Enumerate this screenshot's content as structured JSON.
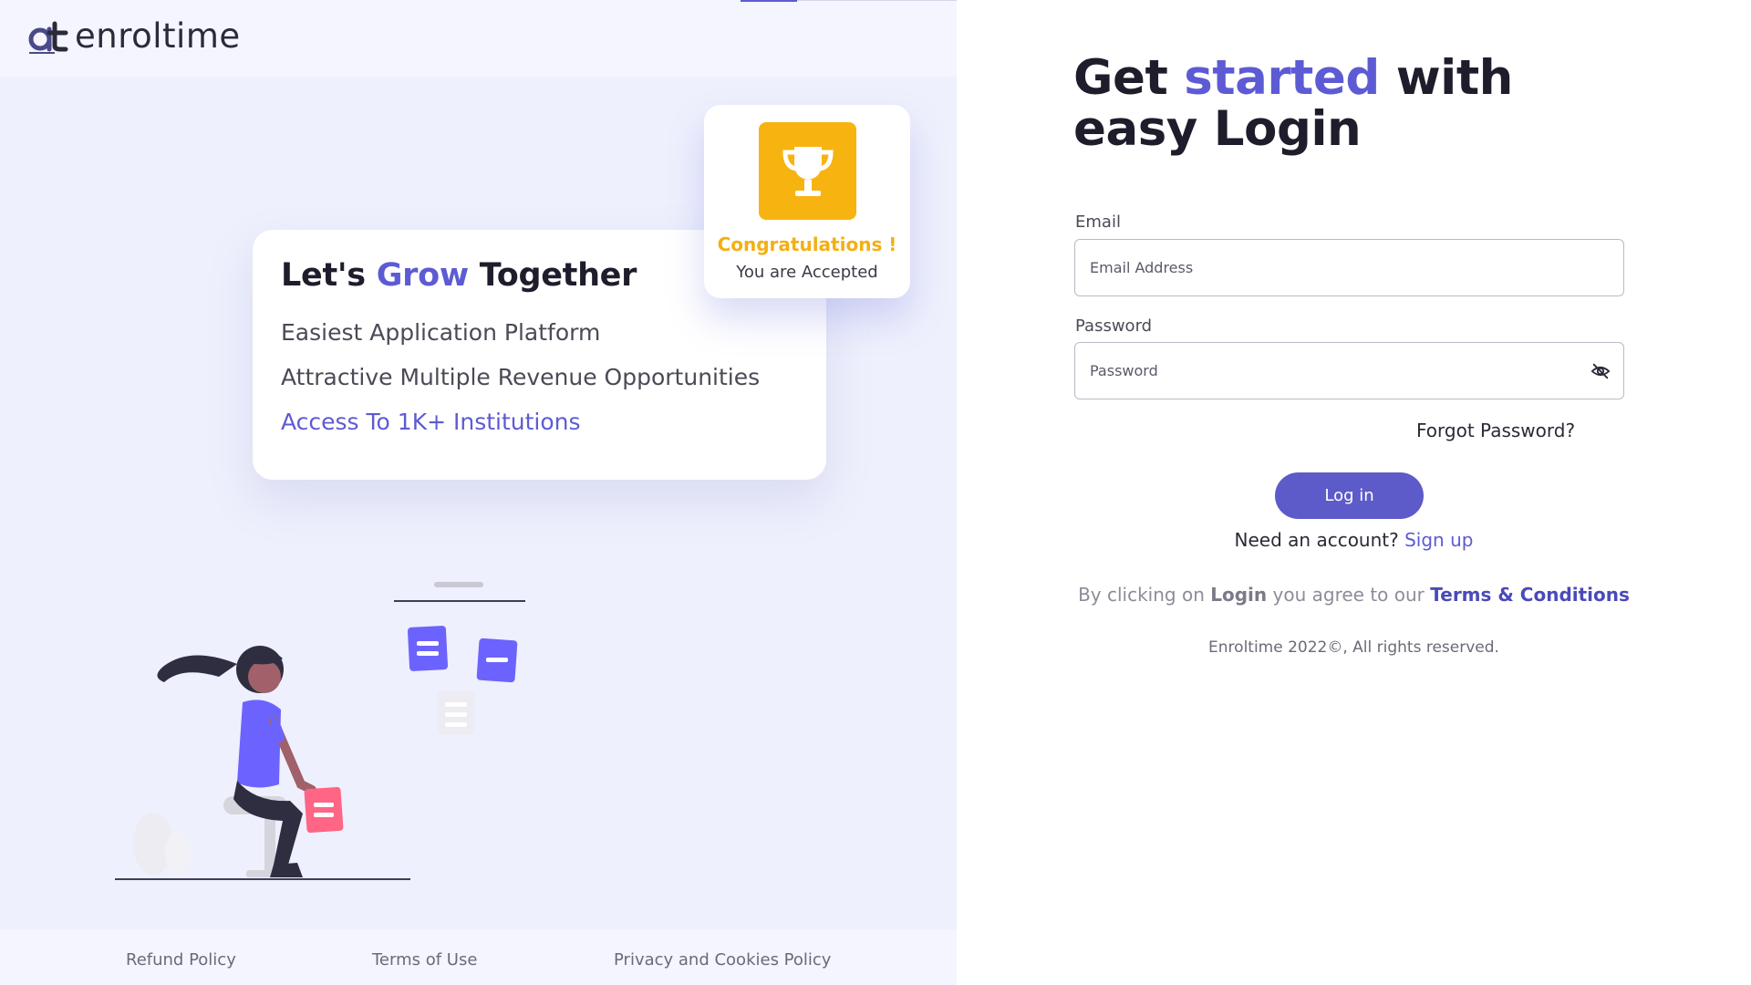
{
  "brand": {
    "name": "enroltime"
  },
  "promo": {
    "congrats_title": "Congratulations !",
    "congrats_sub": "You are Accepted",
    "grow_title_pre": "Let's ",
    "grow_title_accent": "Grow",
    "grow_title_post": " Together",
    "items": [
      "Easiest Application Platform",
      "Attractive Multiple Revenue Opportunities",
      "Access To 1K+ Institutions"
    ]
  },
  "footer": {
    "links": [
      "Refund Policy",
      "Terms of Use",
      "Privacy and Cookies Policy"
    ]
  },
  "login": {
    "heading_pre": "Get ",
    "heading_accent": "started",
    "heading_post": " with",
    "heading_line2": "easy Login",
    "email_label": "Email",
    "email_placeholder": "Email Address",
    "password_label": "Password",
    "password_placeholder": "Password",
    "forgot": "Forgot Password?",
    "login_button": "Log in",
    "need_account": "Need an account?",
    "signup": "Sign up",
    "agree_pre": "By clicking on",
    "agree_login": "Login",
    "agree_mid": "you agree to our",
    "agree_terms": "Terms & Conditions",
    "copyright": "Enroltime 2022©, All rights reserved."
  },
  "colors": {
    "accent": "#5d5bd4",
    "button": "#5d5bc9",
    "trophy": "#f7b411",
    "left_bg": "#eef0fd"
  },
  "icons": {
    "logo": "enroltime-logo-icon",
    "trophy": "trophy-icon",
    "password_toggle": "eye-off-icon"
  }
}
